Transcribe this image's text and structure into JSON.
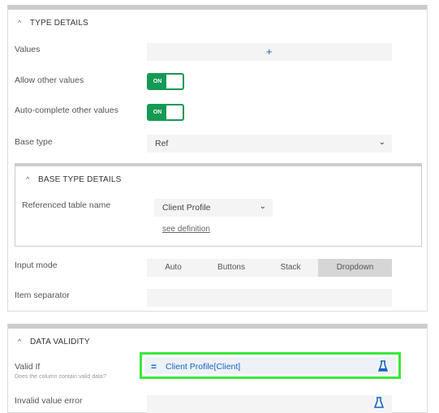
{
  "type_details": {
    "header": "TYPE DETAILS",
    "values_label": "Values",
    "values_add": "+",
    "allow_other_label": "Allow other values",
    "allow_other_toggle": "ON",
    "autocomplete_label": "Auto-complete other values",
    "autocomplete_toggle": "ON",
    "base_type_label": "Base type",
    "base_type_value": "Ref",
    "input_mode_label": "Input mode",
    "input_modes": [
      "Auto",
      "Buttons",
      "Stack",
      "Dropdown"
    ],
    "input_mode_selected": "Dropdown",
    "item_separator_label": "Item separator"
  },
  "base_type_details": {
    "header": "BASE TYPE DETAILS",
    "ref_table_label": "Referenced table name",
    "ref_table_value": "Client Profile",
    "see_definition": "see definition"
  },
  "data_validity": {
    "header": "DATA VALIDITY",
    "valid_if_label": "Valid If",
    "valid_if_sub": "Does the column contain valid data?",
    "valid_if_value": "Client Profile[Client]",
    "invalid_error_label": "Invalid value error"
  },
  "colors": {
    "toggle_on": "#159a55",
    "highlight": "#39e83a",
    "expr_blue": "#1565c0"
  }
}
